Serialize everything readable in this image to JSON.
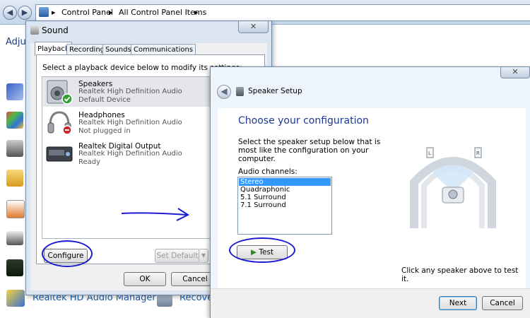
{
  "explorer": {
    "breadcrumb_1": "Control Panel",
    "breadcrumb_2": "All Control Panel Items",
    "sep": "▸",
    "heading_partial": "Adju",
    "bottom_link_1": "Realtek HD Audio Manager",
    "bottom_link_2": "Recove"
  },
  "sound_dialog": {
    "title": "Sound",
    "close_glyph": "✕",
    "tabs": [
      "Playback",
      "Recording",
      "Sounds",
      "Communications"
    ],
    "instruction": "Select a playback device below to modify its settings:",
    "devices": [
      {
        "name": "Speakers",
        "driver": "Realtek High Definition Audio",
        "status": "Default Device"
      },
      {
        "name": "Headphones",
        "driver": "Realtek High Definition Audio",
        "status": "Not plugged in"
      },
      {
        "name": "Realtek Digital Output",
        "driver": "Realtek High Definition Audio",
        "status": "Ready"
      }
    ],
    "configure_label": "Configure",
    "set_default_label": "Set Default",
    "ok_label": "OK",
    "cancel_label": "Cancel"
  },
  "speaker_setup": {
    "title": "Speaker Setup",
    "close_glyph": "✕",
    "heading": "Choose your configuration",
    "description": "Select the speaker setup below that is most like the configuration on your computer.",
    "channels_label": "Audio channels:",
    "channels": [
      "Stereo",
      "Quadraphonic",
      "5.1 Surround",
      "7.1 Surround"
    ],
    "selected_channel": "Stereo",
    "test_label": "Test",
    "click_hint": "Click any speaker above to test it.",
    "next_label": "Next",
    "cancel_label": "Cancel",
    "speaker_left": "L",
    "speaker_right": "R"
  },
  "colors": {
    "accent_blue": "#3399ff",
    "heading_blue": "#1b3a8f",
    "annotation_blue": "#1a1ad0"
  }
}
